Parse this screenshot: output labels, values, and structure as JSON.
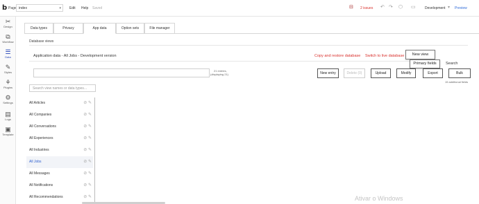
{
  "topbar": {
    "logo": "b",
    "page_label": "Page",
    "page_value": "index",
    "menu": [
      "Edit",
      "Help"
    ],
    "saved": "Saved",
    "issues": "2 issues",
    "version": "Development",
    "preview": "Preview"
  },
  "sidebar": {
    "items": [
      {
        "label": "Design",
        "icon": "✂"
      },
      {
        "label": "Workflow",
        "icon": "⧉"
      },
      {
        "label": "Data",
        "icon": "☰"
      },
      {
        "label": "Styles",
        "icon": "✎"
      },
      {
        "label": "Plugins",
        "icon": "⚘"
      },
      {
        "label": "Settings",
        "icon": "⚙"
      },
      {
        "label": "Logs",
        "icon": "▤"
      },
      {
        "label": "Template",
        "icon": "▣"
      }
    ]
  },
  "tabs": [
    "Data types",
    "Privacy",
    "App data",
    "Option sets",
    "File manager"
  ],
  "main": {
    "section_title": "Database views",
    "db_header": "Application data - All Jobs - Development version",
    "copy_link": "Copy and restore database",
    "switch_link": "Switch to live database",
    "new_view": "New view",
    "primary_fields": "Primary fields",
    "search_label": "Search",
    "entries_count_line1": "21 entries,",
    "entries_count_line2": "(displaying 21)",
    "buttons": {
      "new_entry": "New entry",
      "delete": "Delete (0)",
      "upload": "Upload",
      "modify": "Modify",
      "export": "Export",
      "bulk": "Bulk"
    },
    "additional": "15 additional fields",
    "type_search_placeholder": "Search view names or data types..."
  },
  "views": [
    "All Articles",
    "All Companies",
    "All Conversations",
    "All Experiences",
    "All Industries",
    "All Jobs",
    "All Messages",
    "All Notifications",
    "All Recommendations"
  ],
  "watermark": "Ativar o Windows"
}
